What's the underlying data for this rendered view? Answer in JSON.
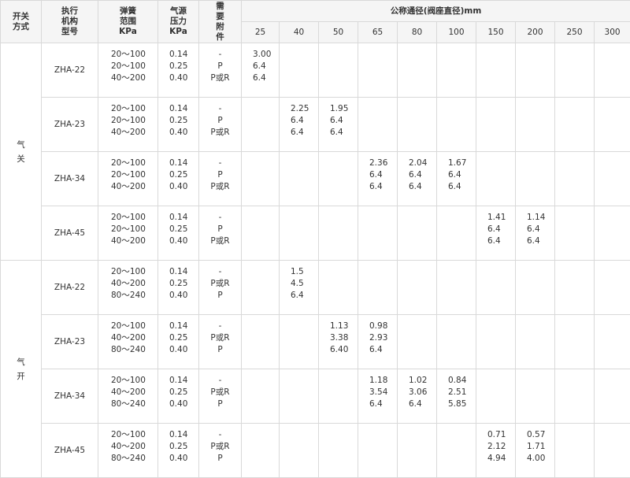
{
  "header": {
    "open_mode": [
      "开关",
      "方式"
    ],
    "actuator": [
      "执行",
      "机构",
      "型号"
    ],
    "spring_range": [
      "弹簧",
      "范围",
      "KPa"
    ],
    "air_pressure": [
      "气源",
      "压力",
      "KPa"
    ],
    "accessories": [
      "需",
      "要",
      "附",
      "件"
    ],
    "nominal_diameter": "公称通径(阀座直径)mm",
    "diameters": [
      "25",
      "40",
      "50",
      "65",
      "80",
      "100",
      "150",
      "200",
      "250",
      "300"
    ]
  },
  "groups": [
    {
      "label": [
        "气",
        "关"
      ],
      "rows": [
        {
          "model": "ZHA-22",
          "spring": [
            "20～100",
            "20～100",
            "40～200"
          ],
          "pressure": [
            "0.14",
            "0.25",
            "0.40"
          ],
          "accessory": [
            "-",
            "P",
            "P或R"
          ],
          "values": [
            [
              "3.00",
              "6.4",
              "6.4"
            ],
            [],
            [],
            [],
            [],
            [],
            [],
            [],
            [],
            []
          ]
        },
        {
          "model": "ZHA-23",
          "spring": [
            "20～100",
            "20～100",
            "40～200"
          ],
          "pressure": [
            "0.14",
            "0.25",
            "0.40"
          ],
          "accessory": [
            "-",
            "P",
            "P或R"
          ],
          "values": [
            [],
            [
              "2.25",
              "6.4",
              "6.4"
            ],
            [
              "1.95",
              "6.4",
              "6.4"
            ],
            [],
            [],
            [],
            [],
            [],
            [],
            []
          ]
        },
        {
          "model": "ZHA-34",
          "spring": [
            "20～100",
            "20～100",
            "40～200"
          ],
          "pressure": [
            "0.14",
            "0.25",
            "0.40"
          ],
          "accessory": [
            "-",
            "P",
            "P或R"
          ],
          "values": [
            [],
            [],
            [],
            [
              "2.36",
              "6.4",
              "6.4"
            ],
            [
              "2.04",
              "6.4",
              "6.4"
            ],
            [
              "1.67",
              "6.4",
              "6.4"
            ],
            [],
            [],
            [],
            []
          ]
        },
        {
          "model": "ZHA-45",
          "spring": [
            "20～100",
            "20～100",
            "40～200"
          ],
          "pressure": [
            "0.14",
            "0.25",
            "0.40"
          ],
          "accessory": [
            "-",
            "P",
            "P或R"
          ],
          "values": [
            [],
            [],
            [],
            [],
            [],
            [],
            [
              "1.41",
              "6.4",
              "6.4"
            ],
            [
              "1.14",
              "6.4",
              "6.4"
            ],
            [],
            []
          ]
        }
      ]
    },
    {
      "label": [
        "气",
        "开"
      ],
      "rows": [
        {
          "model": "ZHA-22",
          "spring": [
            "20～100",
            "40～200",
            "80～240"
          ],
          "pressure": [
            "0.14",
            "0.25",
            "0.40"
          ],
          "accessory": [
            "-",
            "P或R",
            "P"
          ],
          "values": [
            [],
            [
              "1.5",
              "4.5",
              "6.4"
            ],
            [],
            [],
            [],
            [],
            [],
            [],
            [],
            []
          ]
        },
        {
          "model": "ZHA-23",
          "spring": [
            "20～100",
            "40～200",
            "80～240"
          ],
          "pressure": [
            "0.14",
            "0.25",
            "0.40"
          ],
          "accessory": [
            "-",
            "P或R",
            "P"
          ],
          "values": [
            [],
            [],
            [
              "1.13",
              "3.38",
              "6.40"
            ],
            [
              "0.98",
              "2.93",
              "6.4"
            ],
            [],
            [],
            [],
            [],
            [],
            []
          ]
        },
        {
          "model": "ZHA-34",
          "spring": [
            "20～100",
            "40～200",
            "80～240"
          ],
          "pressure": [
            "0.14",
            "0.25",
            "0.40"
          ],
          "accessory": [
            "-",
            "P或R",
            "P"
          ],
          "values": [
            [],
            [],
            [],
            [
              "1.18",
              "3.54",
              "6.4"
            ],
            [
              "1.02",
              "3.06",
              "6.4"
            ],
            [
              "0.84",
              "2.51",
              "5.85"
            ],
            [],
            [],
            [],
            []
          ]
        },
        {
          "model": "ZHA-45",
          "spring": [
            "20～100",
            "40～200",
            "80～240"
          ],
          "pressure": [
            "0.14",
            "0.25",
            "0.40"
          ],
          "accessory": [
            "-",
            "P或R",
            "P"
          ],
          "values": [
            [],
            [],
            [],
            [],
            [],
            [],
            [
              "0.71",
              "2.12",
              "4.94"
            ],
            [
              "0.57",
              "1.71",
              "4.00"
            ],
            [],
            []
          ]
        }
      ]
    }
  ]
}
